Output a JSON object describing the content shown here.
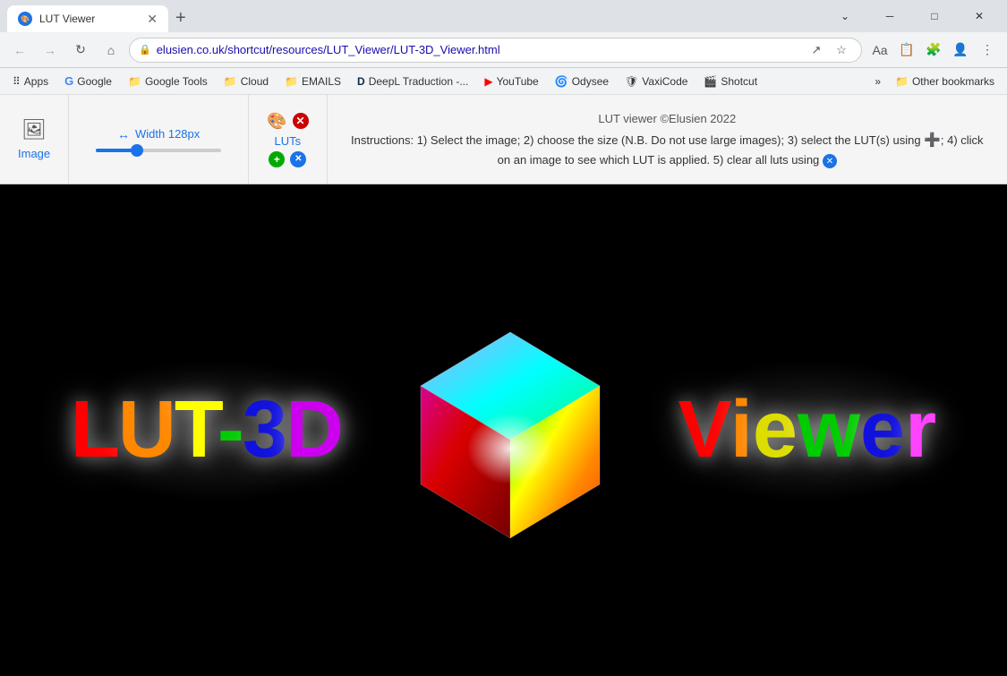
{
  "browser": {
    "tab": {
      "title": "LUT Viewer",
      "favicon": "🎨"
    },
    "url": "elusien.co.uk/shortcut/resources/LUT_Viewer/LUT-3D_Viewer.html",
    "window_controls": {
      "minimize": "─",
      "maximize": "□",
      "close": "✕"
    }
  },
  "bookmarks": {
    "items": [
      {
        "id": "apps",
        "icon": "⠿",
        "label": "Apps"
      },
      {
        "id": "google",
        "icon": "G",
        "label": "Google"
      },
      {
        "id": "google-tools",
        "icon": "📁",
        "label": "Google Tools"
      },
      {
        "id": "cloud",
        "icon": "📁",
        "label": "Cloud"
      },
      {
        "id": "emails",
        "icon": "📁",
        "label": "EMAILS"
      },
      {
        "id": "deepl",
        "icon": "🌐",
        "label": "DeepL Traduction -..."
      },
      {
        "id": "youtube",
        "icon": "▶",
        "label": "YouTube"
      },
      {
        "id": "odysee",
        "icon": "🌀",
        "label": "Odysee"
      },
      {
        "id": "vaxicode",
        "icon": "🛡",
        "label": "VaxiCode"
      },
      {
        "id": "shotcut",
        "icon": "🎬",
        "label": "Shotcut"
      }
    ],
    "more": "»",
    "other_label": "Other bookmarks"
  },
  "toolbar": {
    "image_label": "Image",
    "image_icon": "🖼",
    "width_label": "Width 128px",
    "width_arrows": "↔",
    "slider_value": 30,
    "luts_label": "LUTs",
    "instructions_title": "LUT viewer ©Elusien 2022",
    "instructions_text": "Instructions: 1) Select the image; 2) choose the size (N.B. Do not use large images); 3) select the LUT(s) using ➕; 4) click on an image to see which LUT is applied. 5) clear all luts using ✖"
  },
  "main": {
    "text_left": "LUT-3D",
    "text_right": "Viewer",
    "letters_left": [
      {
        "char": "L",
        "color": "#ff0000"
      },
      {
        "char": "U",
        "color": "#ff8800"
      },
      {
        "char": "T",
        "color": "#ffff00"
      },
      {
        "char": "-",
        "color": "#00cc00"
      },
      {
        "char": "3",
        "color": "#1111dd"
      },
      {
        "char": "D",
        "color": "#cc00ee"
      }
    ],
    "letters_right": [
      {
        "char": "V",
        "color": "#ff0000"
      },
      {
        "char": "i",
        "color": "#ff8800"
      },
      {
        "char": "e",
        "color": "#dddd00"
      },
      {
        "char": "w",
        "color": "#00cc00"
      },
      {
        "char": "e",
        "color": "#1111dd"
      },
      {
        "char": "r",
        "color": "#ff44ff"
      }
    ]
  }
}
